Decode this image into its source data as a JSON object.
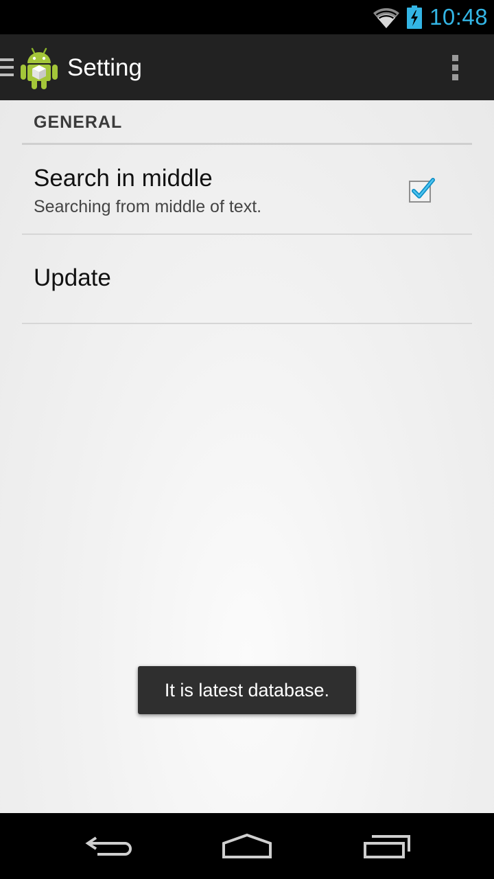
{
  "status_bar": {
    "time": "10:48",
    "wifi_icon": "wifi-icon",
    "battery_icon": "battery-charging-icon",
    "time_color": "#33b5e5"
  },
  "action_bar": {
    "title": "Setting",
    "up_icon": "navigation-drawer-icon",
    "app_icon": "android-app-icon",
    "overflow_icon": "overflow-menu-icon"
  },
  "preferences": {
    "category_general": "GENERAL",
    "search_in_middle": {
      "title": "Search in middle",
      "summary": "Searching from middle of text.",
      "checked": true
    },
    "update": {
      "title": "Update"
    }
  },
  "toast": {
    "message": "It is latest database."
  },
  "nav_bar": {
    "back_icon": "back-icon",
    "home_icon": "home-icon",
    "recents_icon": "recents-icon"
  },
  "colors": {
    "accent": "#33b5e5",
    "action_bar": "#222222",
    "android_green": "#a4c639"
  }
}
